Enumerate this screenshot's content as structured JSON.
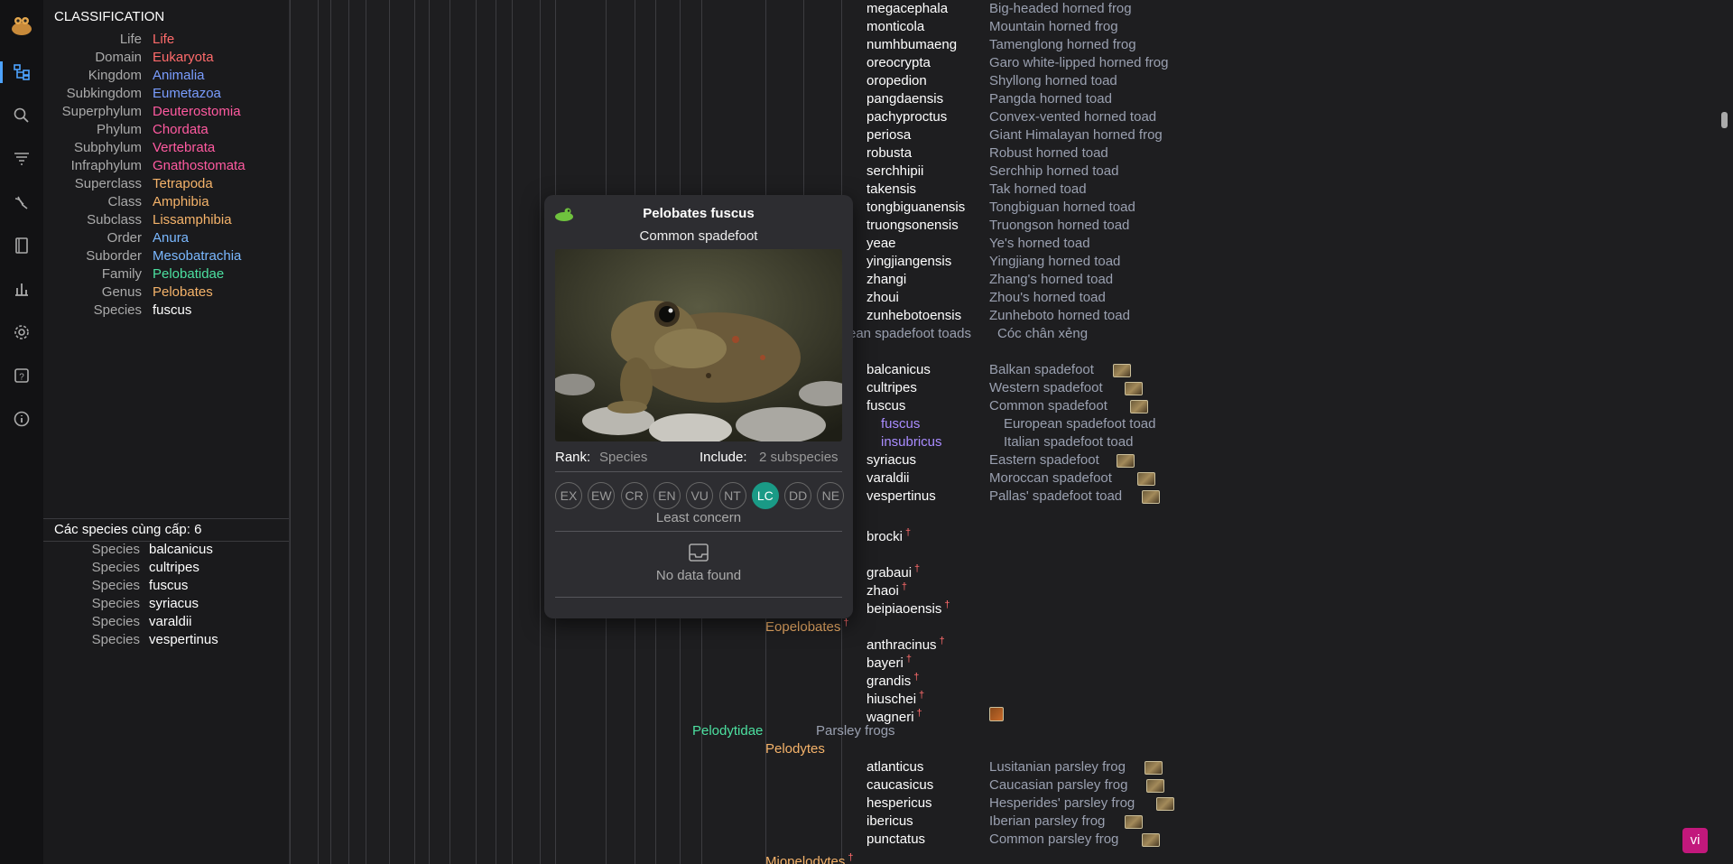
{
  "classification": {
    "title": "CLASSIFICATION",
    "rows": [
      {
        "rank": "Life",
        "name": "Life",
        "color": "#ff6b6b"
      },
      {
        "rank": "Domain",
        "name": "Eukaryota",
        "color": "#ff6b6b"
      },
      {
        "rank": "Kingdom",
        "name": "Animalia",
        "color": "#7a9dff"
      },
      {
        "rank": "Subkingdom",
        "name": "Eumetazoa",
        "color": "#7a9dff"
      },
      {
        "rank": "Superphylum",
        "name": "Deuterostomia",
        "color": "#ff5aa0"
      },
      {
        "rank": "Phylum",
        "name": "Chordata",
        "color": "#ff5aa0"
      },
      {
        "rank": "Subphylum",
        "name": "Vertebrata",
        "color": "#ff5aa0"
      },
      {
        "rank": "Infraphylum",
        "name": "Gnathostomata",
        "color": "#ff5aa0"
      },
      {
        "rank": "Superclass",
        "name": "Tetrapoda",
        "color": "#f5b36a"
      },
      {
        "rank": "Class",
        "name": "Amphibia",
        "color": "#f5b36a"
      },
      {
        "rank": "Subclass",
        "name": "Lissamphibia",
        "color": "#f5b36a"
      },
      {
        "rank": "Order",
        "name": "Anura",
        "color": "#7ab8ff"
      },
      {
        "rank": "Suborder",
        "name": "Mesobatrachia",
        "color": "#7ab8ff"
      },
      {
        "rank": "Family",
        "name": "Pelobatidae",
        "color": "#4ce0a0"
      },
      {
        "rank": "Genus",
        "name": "Pelobates",
        "color": "#f5b36a"
      },
      {
        "rank": "Species",
        "name": "fuscus",
        "color": "#ffffff"
      }
    ]
  },
  "siblings": {
    "title": "Các species cùng cấp: 6",
    "rank": "Species",
    "items": [
      "balcanicus",
      "cultripes",
      "fuscus",
      "syriacus",
      "varaldii",
      "vespertinus"
    ]
  },
  "tree": {
    "top_species": [
      {
        "name": "megacephala",
        "common": "Big-headed horned frog"
      },
      {
        "name": "monticola",
        "common": "Mountain horned frog"
      },
      {
        "name": "numhbumaeng",
        "common": "Tamenglong horned frog"
      },
      {
        "name": "oreocrypta",
        "common": "Garo white-lipped horned frog"
      },
      {
        "name": "oropedion",
        "common": "Shyllong horned toad"
      },
      {
        "name": "pangdaensis",
        "common": "Pangda horned toad"
      },
      {
        "name": "pachyproctus",
        "common": "Convex-vented horned toad"
      },
      {
        "name": "periosa",
        "common": "Giant Himalayan horned frog"
      },
      {
        "name": "robusta",
        "common": "Robust horned toad"
      },
      {
        "name": "serchhipii",
        "common": "Serchhip horned toad"
      },
      {
        "name": "takensis",
        "common": "Tak horned toad"
      },
      {
        "name": "tongbiguanensis",
        "common": "Tongbiguan horned toad"
      },
      {
        "name": "truongsonensis",
        "common": "Truongson horned toad"
      },
      {
        "name": "yeae",
        "common": "Ye's horned toad"
      },
      {
        "name": "yingjiangensis",
        "common": "Yingjiang horned toad"
      },
      {
        "name": "zhangi",
        "common": "Zhang's horned toad"
      },
      {
        "name": "zhoui",
        "common": "Zhou's horned toad"
      },
      {
        "name": "zunhebotoensis",
        "common": "Zunheboto horned toad"
      }
    ],
    "family_common": "ean spadefoot toads",
    "family_vi": "Cóc chân xẻng",
    "pelobates_species": [
      {
        "name": "balcanicus",
        "common": "Balkan spadefoot"
      },
      {
        "name": "cultripes",
        "common": "Western spadefoot"
      },
      {
        "name": "fuscus",
        "common": "Common spadefoot"
      }
    ],
    "subspecies": [
      {
        "name": "fuscus",
        "common": "European spadefoot toad"
      },
      {
        "name": "insubricus",
        "common": "Italian spadefoot toad"
      }
    ],
    "pelobates_species2": [
      {
        "name": "syriacus",
        "common": "Eastern spadefoot"
      },
      {
        "name": "varaldii",
        "common": "Moroccan spadefoot"
      },
      {
        "name": "vespertinus",
        "common": "Pallas' spadefoot toad"
      }
    ],
    "extinct_a": [
      "brocki"
    ],
    "extinct_b": [
      "grabaui",
      "zhaoi",
      "beipiaoensis"
    ],
    "genus_eopelobates": "Eopelobates",
    "extinct_c": [
      "anthracinus",
      "bayeri",
      "grandis",
      "hiuschei",
      "wagneri"
    ],
    "dagger": "†",
    "family_pelodytidae": "Pelodytidae",
    "family_pelodytidae_common": "Parsley frogs",
    "genus_pelodytes": "Pelodytes",
    "pelodytes_species": [
      {
        "name": "atlanticus",
        "common": "Lusitanian parsley frog"
      },
      {
        "name": "caucasicus",
        "common": "Caucasian parsley frog"
      },
      {
        "name": "hespericus",
        "common": "Hesperides' parsley frog"
      },
      {
        "name": "ibericus",
        "common": "Iberian parsley frog"
      },
      {
        "name": "punctatus",
        "common": "Common parsley frog"
      }
    ],
    "genus_miopelodytes": "Miopelodytes"
  },
  "popup": {
    "title": "Pelobates fuscus",
    "subtitle": "Common spadefoot",
    "rank_label": "Rank:",
    "rank_value": "Species",
    "include_label": "Include:",
    "include_value": "2 subspecies",
    "iucn": [
      "EX",
      "EW",
      "CR",
      "EN",
      "VU",
      "NT",
      "LC",
      "DD",
      "NE"
    ],
    "iucn_active": "LC",
    "status_text": "Least concern",
    "nodata_text": "No data found"
  },
  "language_badge": "vi"
}
